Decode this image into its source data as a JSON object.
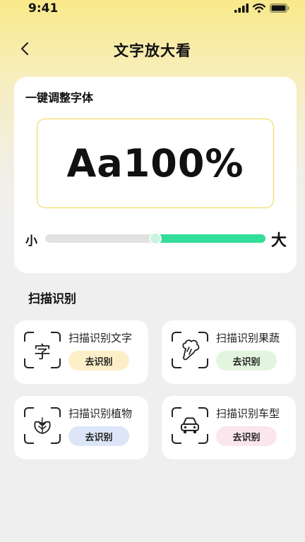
{
  "status_bar": {
    "time": "9:41"
  },
  "header": {
    "title": "文字放大看"
  },
  "font_adjust": {
    "title": "一键调整字体",
    "preview_text": "Aa100%",
    "slider_small_label": "小",
    "slider_large_label": "大",
    "slider_value_fraction": 0.5
  },
  "scan_section": {
    "title": "扫描识别",
    "items": [
      {
        "label": "扫描识别文字",
        "button": "去识别",
        "icon": "text-character-icon",
        "icon_glyph": "字",
        "button_color": "#fcefc8"
      },
      {
        "label": "扫描识别果蔬",
        "button": "去识别",
        "icon": "vegetable-icon",
        "button_color": "#e3f5df"
      },
      {
        "label": "扫描识别植物",
        "button": "去识别",
        "icon": "leaf-icon",
        "button_color": "#dce6f8"
      },
      {
        "label": "扫描识别车型",
        "button": "去识别",
        "icon": "car-icon",
        "button_color": "#fbe5ee"
      }
    ]
  }
}
